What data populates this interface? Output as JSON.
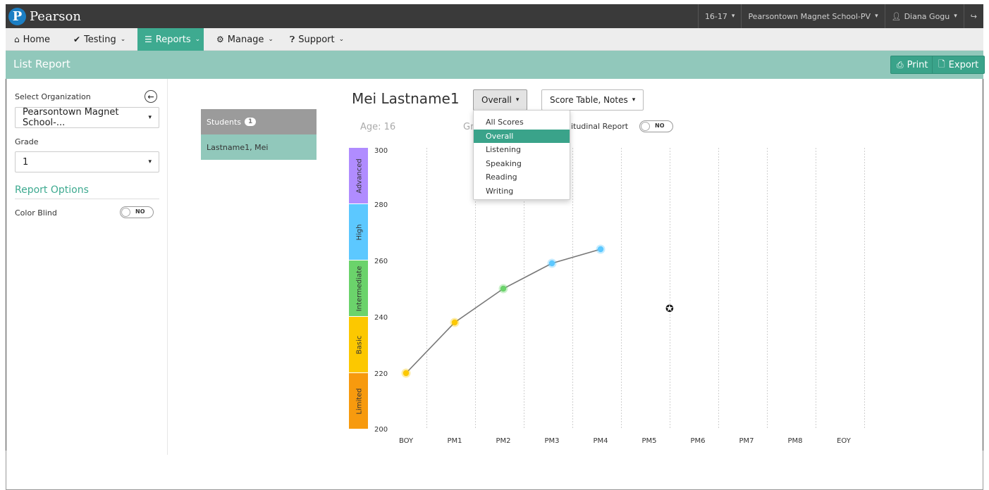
{
  "header": {
    "brand": "Pearson",
    "brand_initial": "P",
    "year": "16-17",
    "school": "Pearsontown Magnet School-PV",
    "user": "Diana Gogu"
  },
  "nav": {
    "home": "Home",
    "testing": "Testing",
    "reports": "Reports",
    "manage": "Manage",
    "support": "Support"
  },
  "titlebar": {
    "title": "List Report",
    "print": "Print",
    "export": "Export"
  },
  "left": {
    "org_label": "Select Organization",
    "org_value": "Pearsontown Magnet School-...",
    "grade_label": "Grade",
    "grade_value": "1",
    "report_options": "Report Options",
    "color_blind": "Color Blind",
    "color_blind_toggle": "NO"
  },
  "students": {
    "label": "Students",
    "count": "1",
    "rows": [
      "Lastname1, Mei"
    ]
  },
  "main": {
    "student_name": "Mei Lastname1",
    "score_dropdown": "Overall",
    "view_dropdown": "Score Table, Notes",
    "age": "Age: 16",
    "grade_partial": "Gr",
    "longitudinal": "ngitudinal Report",
    "longitudinal_toggle": "NO"
  },
  "menu": {
    "items": [
      "All Scores",
      "Overall",
      "Listening",
      "Speaking",
      "Reading",
      "Writing"
    ],
    "selected": "Overall"
  },
  "colors": {
    "accent": "#3aa38a",
    "limited": "#f79a0e",
    "basic": "#fcc800",
    "intermediate": "#6bd36b",
    "high": "#5cc8ff",
    "advanced": "#b08cff"
  },
  "chart_data": {
    "type": "line",
    "categories": [
      "BOY",
      "PM1",
      "PM2",
      "PM3",
      "PM4",
      "PM5",
      "PM6",
      "PM7",
      "PM8",
      "EOY"
    ],
    "values": [
      220,
      238,
      250,
      259,
      264,
      null,
      null,
      null,
      null,
      null
    ],
    "point_levels": [
      "Basic",
      "Basic",
      "Intermediate",
      "High",
      "High"
    ],
    "ylim": [
      200,
      300
    ],
    "yticks": [
      200,
      220,
      240,
      260,
      280,
      300
    ],
    "bands": [
      {
        "name": "Limited",
        "from": 200,
        "to": 220
      },
      {
        "name": "Basic",
        "from": 220,
        "to": 240
      },
      {
        "name": "Intermediate",
        "from": 240,
        "to": 260
      },
      {
        "name": "High",
        "from": 260,
        "to": 280
      },
      {
        "name": "Advanced",
        "from": 280,
        "to": 300
      }
    ]
  }
}
